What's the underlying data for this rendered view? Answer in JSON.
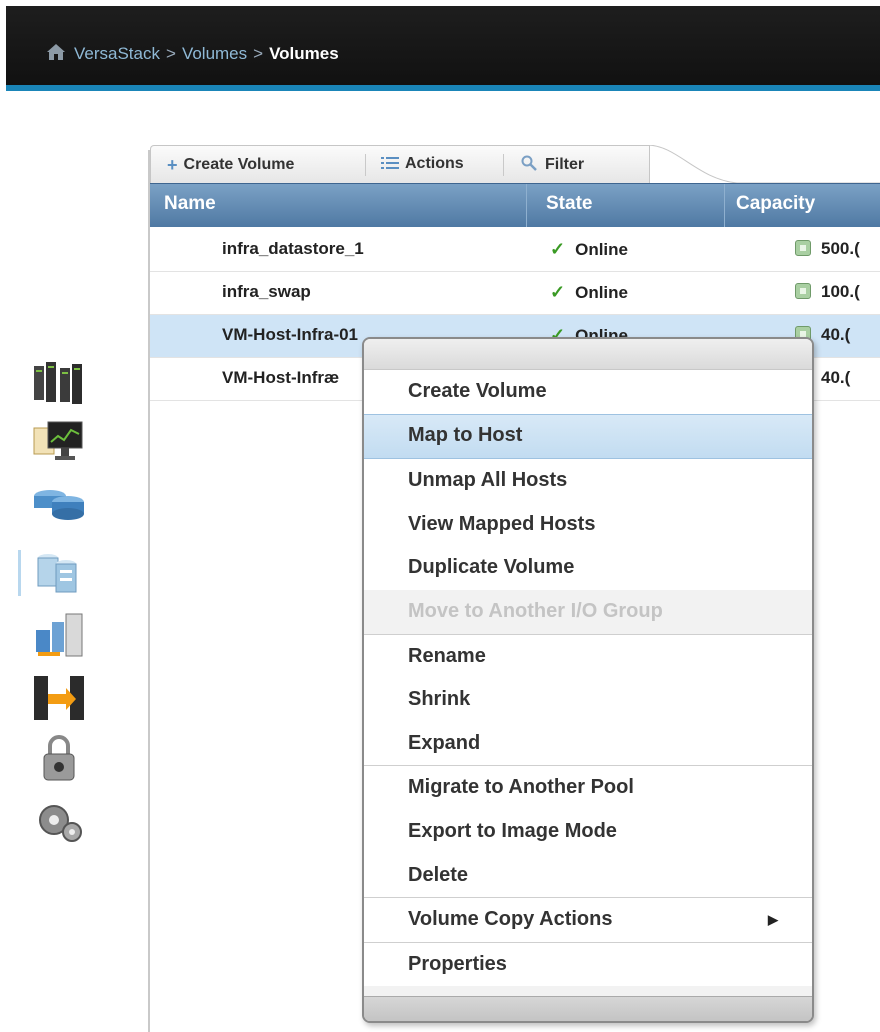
{
  "breadcrumb": {
    "root": "VersaStack",
    "sep1": ">",
    "level2": "Volumes",
    "sep2": ">",
    "current": "Volumes"
  },
  "toolbar": {
    "create_volume": "Create Volume",
    "actions": "Actions",
    "filter": "Filter"
  },
  "grid": {
    "columns": [
      "Name",
      "State",
      "Capacity"
    ],
    "rows": [
      {
        "name": "infra_datastore_1",
        "state": "Online",
        "capacity": "500.("
      },
      {
        "name": "infra_swap",
        "state": "Online",
        "capacity": "100.("
      },
      {
        "name": "VM-Host-Infra-01",
        "state": "Online",
        "capacity": "40.("
      },
      {
        "name": "VM-Host-Infræ",
        "state": "",
        "capacity": "40.("
      }
    ]
  },
  "context_menu": {
    "items": [
      "Create Volume",
      "Map to Host",
      "Unmap All Hosts",
      "View Mapped Hosts",
      "Duplicate Volume",
      "Move to Another I/O Group",
      "Rename",
      "Shrink",
      "Expand",
      "Migrate to Another Pool",
      "Export to Image Mode",
      "Delete",
      "Volume Copy Actions",
      "Properties"
    ],
    "submenu_arrow": "▶"
  },
  "icons": {
    "home": "home-icon",
    "create": "plus-icon",
    "actions": "list-icon",
    "filter": "magnifier-icon",
    "check": "✓",
    "nav": [
      "monitoring-icon",
      "pools-icon",
      "volumes-icon",
      "hosts-icon",
      "copy-services-icon",
      "access-icon",
      "settings-icon"
    ]
  },
  "colors": {
    "header_bg": "#151515",
    "accent": "#1a85b8",
    "grid_header": "#5f86ad",
    "selected_row": "#cfe4f6",
    "check_green": "#3a9a24"
  }
}
